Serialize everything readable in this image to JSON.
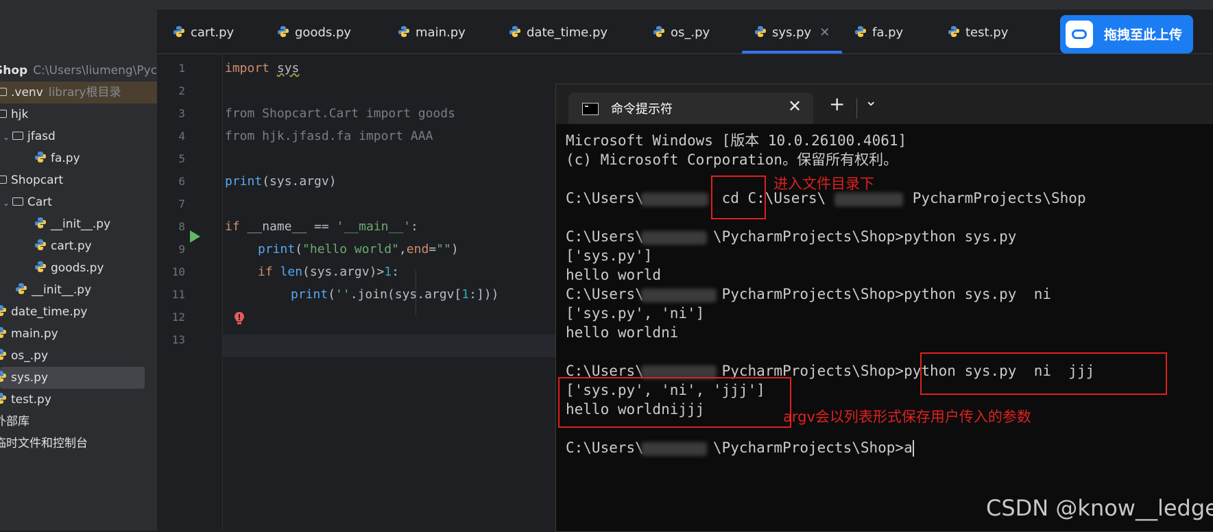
{
  "project_tree": [
    {
      "label": "Shop",
      "muted": "C:\\Users\\liumeng\\Pyc",
      "kind": "root"
    },
    {
      "label": ".venv",
      "muted": "library根目录",
      "kind": "folder"
    },
    {
      "label": "hjk",
      "kind": "folder"
    },
    {
      "label": "jfasd",
      "kind": "folder"
    },
    {
      "label": "fa.py",
      "kind": "file"
    },
    {
      "label": "Shopcart",
      "kind": "folder"
    },
    {
      "label": "Cart",
      "kind": "folder"
    },
    {
      "label": "__init__.py",
      "kind": "file"
    },
    {
      "label": "cart.py",
      "kind": "file"
    },
    {
      "label": "goods.py",
      "kind": "file"
    },
    {
      "label": "__init__.py",
      "kind": "file"
    },
    {
      "label": "date_time.py",
      "kind": "file"
    },
    {
      "label": "main.py",
      "kind": "file"
    },
    {
      "label": "os_.py",
      "kind": "file"
    },
    {
      "label": "sys.py",
      "kind": "file",
      "selected": true
    },
    {
      "label": "test.py",
      "kind": "file"
    },
    {
      "label": "外部库",
      "kind": "group"
    },
    {
      "label": "临时文件和控制台",
      "kind": "group"
    }
  ],
  "tabs": [
    "cart.py",
    "goods.py",
    "main.py",
    "date_time.py",
    "os_.py",
    "sys.py",
    "fa.py",
    "test.py"
  ],
  "active_tab": "sys.py",
  "line_numbers": [
    "1",
    "2",
    "3",
    "4",
    "5",
    "6",
    "7",
    "8",
    "9",
    "10",
    "11",
    "12",
    "13"
  ],
  "code": {
    "l1_kw": "import",
    "l1_mod": "sys",
    "l3": "from Shopcart.Cart import goods",
    "l4": "from hjk.jfasd.fa import AAA",
    "l6_fn": "print",
    "l6_rest": "(sys.argv)",
    "l8_kw": "if",
    "l8_name": "__name__",
    "l8_op": " == ",
    "l8_str": "'__main__'",
    "l8_colon": ":",
    "l9_fn": "print",
    "l9_open": "(",
    "l9_str": "\"hello world\"",
    "l9_comma": ",",
    "l9_kw": "end",
    "l9_eq": "=",
    "l9_str2": "\"\"",
    "l9_close": ")",
    "l10_kw": "if",
    "l10_fn": "len",
    "l10_rest": "(sys.argv)>",
    "l10_num": "1",
    "l10_colon": ":",
    "l11_fn": "print",
    "l11_a": "(",
    "l11_str": "''",
    "l11_b": ".join(sys.argv[",
    "l11_num": "1",
    "l11_c": ":]))"
  },
  "terminal": {
    "tab_title": "命令提示符",
    "lines": [
      "Microsoft Windows [版本 10.0.26100.4061]",
      "(c) Microsoft Corporation。保留所有权利。",
      "",
      "C:\\Users\\         cd C:\\Users\\          PycharmProjects\\Shop",
      "",
      "C:\\Users\\        \\PycharmProjects\\Shop>python sys.py",
      "['sys.py']",
      "hello world",
      "C:\\Users\\         PycharmProjects\\Shop>python sys.py  ni",
      "['sys.py', 'ni']",
      "hello worldni",
      "",
      "C:\\Users\\         PycharmProjects\\Shop>python sys.py  ni  jjj",
      "['sys.py', 'ni', 'jjj']",
      "hello worldnijjj",
      "",
      "C:\\Users\\        \\PycharmProjects\\Shop>a"
    ]
  },
  "annotations": {
    "cd_note": "进入文件目录下",
    "argv_note": "argv会以列表形式保存用户传入的参数"
  },
  "upload_button": "拖拽至此上传",
  "watermark": "CSDN @know__ledge",
  "colors": {
    "accent": "#3574f0",
    "annotation_red": "#e02020",
    "upload_blue": "#1c7cf2"
  }
}
